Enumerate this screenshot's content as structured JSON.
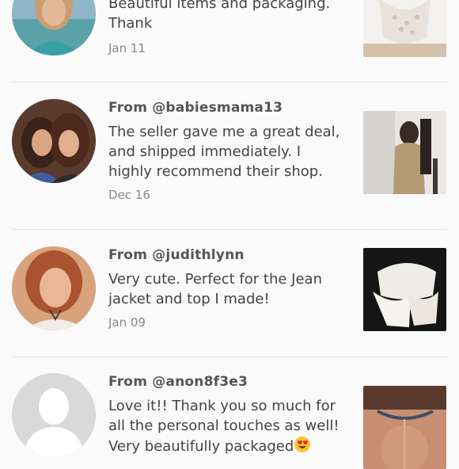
{
  "reviews": [
    {
      "from": "",
      "text": "Beautiful items and packaging. Thank",
      "date": "Jan 11",
      "avatar": "woman-blonde-photo",
      "thumb": "white-lace-top-photo"
    },
    {
      "from": "From @babiesmama13",
      "text": "The seller gave me a great deal, and shipped immediately. I highly recommend their shop.",
      "date": "Dec 16",
      "avatar": "two-women-selfie-photo",
      "thumb": "gold-sequin-dress-photo"
    },
    {
      "from": "From @judithlynn",
      "text": "Very cute. Perfect for the Jean jacket and top I made!",
      "date": "Jan 09",
      "avatar": "woman-redhead-photo",
      "thumb": "white-ruffle-garment-photo"
    },
    {
      "from": "From @anon8f3e3",
      "text": "Love it!! Thank you so much for all the personal touches as well! Very beautifully packaged",
      "emoji": "heart-eyes-emoji",
      "date": "",
      "avatar": "default-avatar-icon",
      "thumb": "back-necklace-photo"
    }
  ]
}
